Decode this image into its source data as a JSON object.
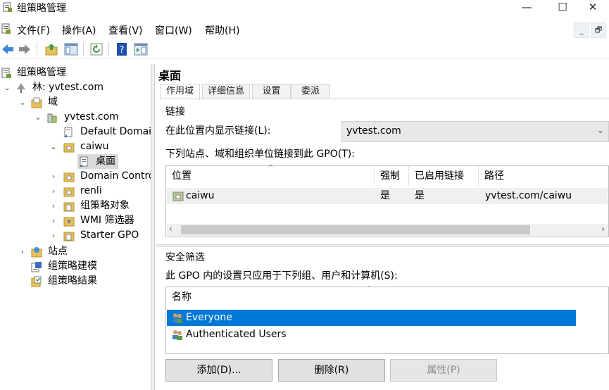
{
  "window": {
    "title": "组策略管理",
    "controls": {
      "minimize": "—",
      "maximize": "☐",
      "close": "✕"
    }
  },
  "menu": {
    "items": [
      "文件(F)",
      "操作(A)",
      "查看(V)",
      "窗口(W)",
      "帮助(H)"
    ],
    "mdi": {
      "minimize": "_",
      "restore": "🗗"
    }
  },
  "toolbar": {
    "icons": [
      "back-arrow-icon",
      "forward-arrow-icon",
      "up-folder-icon",
      "show-hide-tree-icon",
      "refresh-icon",
      "help-icon",
      "properties-pane-icon"
    ]
  },
  "tree": {
    "root": "组策略管理",
    "forest": "林: yvtest.com",
    "domains": "域",
    "domain": "yvtest.com",
    "default_domain": "Default Domair",
    "caiwu": "caiwu",
    "desktop": "桌面",
    "domain_controllers": "Domain Contro",
    "renli": "renli",
    "gpo_objects": "组策略对象",
    "wmi_filters": "WMI 筛选器",
    "starter_gpo": "Starter GPO",
    "sites": "站点",
    "modeling": "组策略建模",
    "results": "组策略结果"
  },
  "detail": {
    "heading": "桌面",
    "tabs": [
      "作用域",
      "详细信息",
      "设置",
      "委派"
    ],
    "links_section": "链接",
    "display_links_label": "在此位置内显示链接(L):",
    "display_links_value": "yvtest.com",
    "linked_label": "下列站点、域和组织单位链接到此 GPO(T):",
    "links_table": {
      "columns": [
        "位置",
        "强制",
        "已启用链接",
        "路径"
      ],
      "rows": [
        {
          "location": "caiwu",
          "enforced": "是",
          "enabled": "是",
          "path": "yvtest.com/caiwu"
        }
      ]
    },
    "security_section": "安全筛选",
    "security_label": "此 GPO 内的设置只应用于下列组、用户和计算机(S):",
    "security_table": {
      "column": "名称",
      "rows": [
        "Everyone",
        "Authenticated Users"
      ],
      "selected_index": 0
    },
    "buttons": {
      "add": "添加(D)...",
      "remove": "删除(R)",
      "properties": "属性(P)"
    }
  },
  "colors": {
    "selection": "#0078d7",
    "tree_selection": "#d9d9d9"
  }
}
